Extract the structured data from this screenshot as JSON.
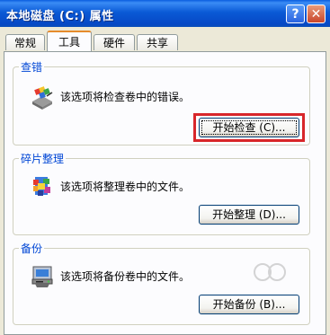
{
  "window": {
    "title": "本地磁盘 (C:) 属性",
    "help_label": "?",
    "close_label": "✕"
  },
  "tabs": [
    {
      "label": "常规"
    },
    {
      "label": "工具",
      "active": true
    },
    {
      "label": "硬件"
    },
    {
      "label": "共享"
    }
  ],
  "groups": {
    "check": {
      "title": "查错",
      "description": "该选项将检查卷中的错误。",
      "button": "开始检查 (C)...",
      "icon": "disk-check-icon"
    },
    "defrag": {
      "title": "碎片整理",
      "description": "该选项将整理卷中的文件。",
      "button": "开始整理 (D)...",
      "icon": "defrag-icon"
    },
    "backup": {
      "title": "备份",
      "description": "该选项将备份卷中的文件。",
      "button": "开始备份 (B)...",
      "icon": "backup-icon"
    }
  },
  "colors": {
    "titlebar": "#0a5ad6",
    "highlight": "#d8262a",
    "group_title": "#0046d5",
    "active_tab_accent": "#e68b2c"
  }
}
